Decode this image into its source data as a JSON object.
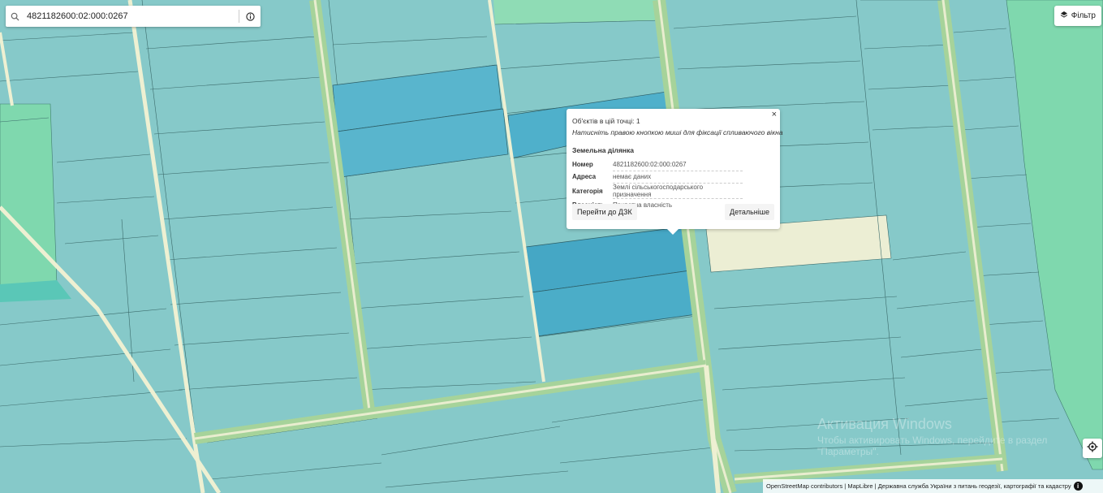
{
  "search": {
    "value": "4821182600:02:000:0267",
    "icon": "search-icon",
    "info_icon": "info-icon"
  },
  "filter": {
    "label": "Фільтр",
    "icon": "layers-icon"
  },
  "popup": {
    "close": "×",
    "count": "Об'єктів в цій точці: 1",
    "hint": "Натисніть правою кнопкою миші для фіксації спливаючого вікна",
    "title": "Земельна ділянка",
    "rows": [
      {
        "key": "Номер",
        "value": "4821182600:02:000:0267"
      },
      {
        "key": "Адреса",
        "value": "немає даних"
      },
      {
        "key": "Категорія",
        "value": "Землі сільськогосподарського призначення"
      },
      {
        "key": "Власність",
        "value": "Приватна власність"
      }
    ],
    "goto_label": "Перейти до ДЗК",
    "details_label": "Детальніше"
  },
  "locate": {
    "icon": "crosshair-icon"
  },
  "attribution": {
    "text": "OpenStreetMap contributors | MapLibre | Державна служба України з питань геодезії, картографії та кадастру",
    "info": "i"
  },
  "watermark": {
    "line1": "Активация Windows",
    "line2": "Чтобы активировать Windows, перейдите в раздел \"Параметры\"."
  },
  "colors": {
    "parcel": "#8ccaca",
    "parcel_highlight": "#58b4cc",
    "parcel_selected": "#46a8c6",
    "field_green": "#7ed9ad",
    "road": "#eef0d2",
    "road_strip": "#a9d49b",
    "parcel_outline": "#3a6a6a"
  }
}
